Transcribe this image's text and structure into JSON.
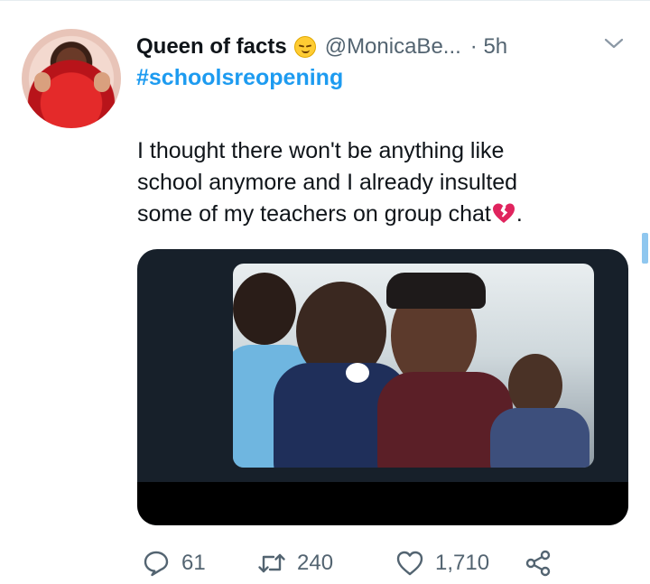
{
  "tweet": {
    "display_name": "Queen of facts",
    "name_emoji": "relieved-face-emoji",
    "handle": "@MonicaBe...",
    "time": "· 5h",
    "hashtag": "#schoolsreopening",
    "text_lines": [
      "I thought there won't be anything like",
      "school anymore and I already insulted",
      "some of my teachers on group chat"
    ],
    "text_end_emoji": "broken-heart-emoji",
    "text_end_punct": ".",
    "media_description_icon": "photo"
  },
  "actions": {
    "replies": "61",
    "retweets": "240",
    "likes": "1,710"
  },
  "colors": {
    "link": "#1d9bf0",
    "secondary_text": "#536471",
    "media_background": "#17202a"
  }
}
